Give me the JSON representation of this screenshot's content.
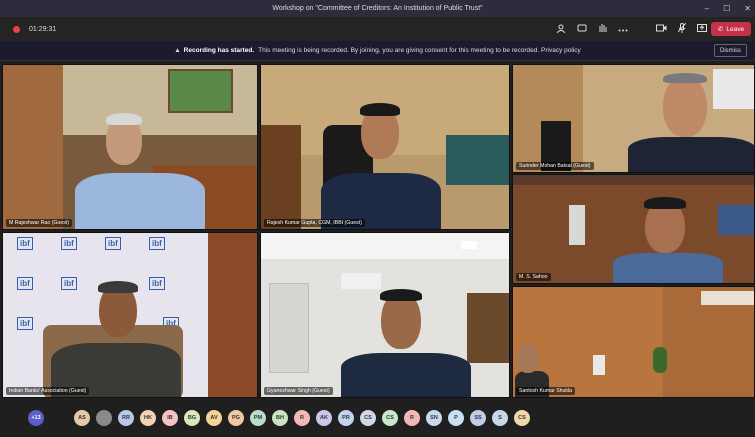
{
  "window": {
    "title": "Workshop on \"Committee of Creditors: An Institution of Public Trust\"",
    "min": "–",
    "max": "☐",
    "close": "✕"
  },
  "toolbar": {
    "timer": "01:29:31",
    "leave_label": "Leave"
  },
  "banner": {
    "heading": "Recording has started.",
    "text": "This meeting is being recorded. By joining, you are giving consent for this meeting to be recorded. Privacy policy",
    "dismiss_label": "Dismiss"
  },
  "tiles": [
    {
      "name": "M Rajeshwar Rao (Guest)"
    },
    {
      "name": "Rajesh Kumar Gupta, CGM, IBBI (Guest)"
    },
    {
      "name": "Surinder Mohan Batsal (Guest)"
    },
    {
      "name": "M. S. Sahoo"
    },
    {
      "name": "Indian Banks' Association (Guest)"
    },
    {
      "name": "Gyaneshwar Singh (Guest)"
    },
    {
      "name": "Santosh Kumar Shukla"
    }
  ],
  "ibf_text": "ibf",
  "participants": {
    "overflow": "+13",
    "avatars": [
      {
        "initials": "AS",
        "color": "#e8c9a7"
      },
      {
        "initials": "",
        "color": "#8a8a8a"
      },
      {
        "initials": "RR",
        "color": "#b9c8e8"
      },
      {
        "initials": "HK",
        "color": "#f2d2b2"
      },
      {
        "initials": "IB",
        "color": "#f3c2c2"
      },
      {
        "initials": "BG",
        "color": "#d8e8b8"
      },
      {
        "initials": "AV",
        "color": "#f3d39a"
      },
      {
        "initials": "PG",
        "color": "#f0c9a2"
      },
      {
        "initials": "PM",
        "color": "#b8e0c8"
      },
      {
        "initials": "BH",
        "color": "#c8e4c0"
      },
      {
        "initials": "R",
        "color": "#f2b8b8"
      },
      {
        "initials": "AK",
        "color": "#c8c8e8"
      },
      {
        "initials": "PR",
        "color": "#c0d4f0"
      },
      {
        "initials": "CS",
        "color": "#d0d8e8"
      },
      {
        "initials": "CS",
        "color": "#c8e8c8"
      },
      {
        "initials": "R",
        "color": "#f2b8b8"
      },
      {
        "initials": "SN",
        "color": "#c8d8f0"
      },
      {
        "initials": "P",
        "color": "#c8e0f4"
      },
      {
        "initials": "SS",
        "color": "#c0cce8"
      },
      {
        "initials": "S",
        "color": "#c8d8e8"
      },
      {
        "initials": "CS",
        "color": "#f0d8a8"
      }
    ]
  }
}
